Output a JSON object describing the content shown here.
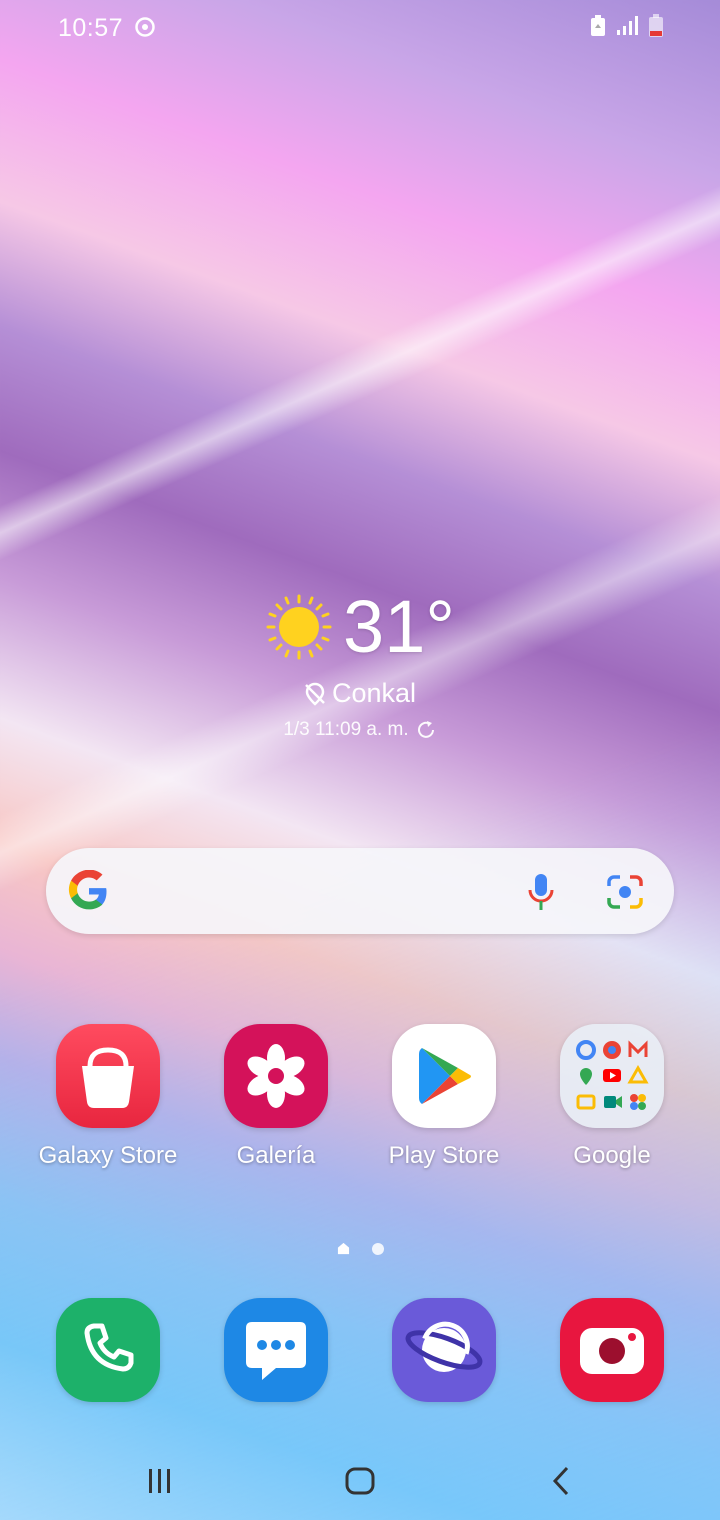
{
  "status_bar": {
    "time": "10:57"
  },
  "weather": {
    "temperature": "31°",
    "location": "Conkal",
    "updated": "1/3 11:09 a. m."
  },
  "apps": [
    {
      "label": "Galaxy Store",
      "icon": "galaxy-store-icon",
      "color": "#f0334b"
    },
    {
      "label": "Galería",
      "icon": "gallery-icon",
      "color": "#d4125a"
    },
    {
      "label": "Play Store",
      "icon": "play-store-icon",
      "color": "#ffffff"
    },
    {
      "label": "Google",
      "icon": "google-folder-icon",
      "color": "#e8eef5"
    }
  ],
  "dock": [
    {
      "icon": "phone-icon",
      "color": "#1db16a"
    },
    {
      "icon": "messages-icon",
      "color": "#1e88e5"
    },
    {
      "icon": "internet-icon",
      "color": "#6a5ad9"
    },
    {
      "icon": "camera-icon",
      "color": "#e8163f"
    }
  ],
  "page_indicator": {
    "current": 1,
    "total": 2
  }
}
